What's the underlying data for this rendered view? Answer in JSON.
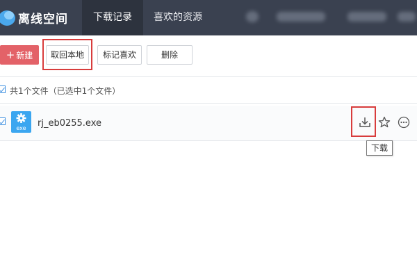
{
  "app": {
    "title": "离线空间",
    "icon": "cloud-logo-icon"
  },
  "tabs": [
    {
      "label": "下载记录",
      "active": true
    },
    {
      "label": "喜欢的资源",
      "active": false
    }
  ],
  "toolbar": {
    "new_label": "新建",
    "new_icon": "plus-icon",
    "fetch_label": "取回本地",
    "mark_label": "标记喜欢",
    "delete_label": "删除"
  },
  "summary": {
    "text": "共1个文件（已选中1个文件）",
    "checked": true
  },
  "files": [
    {
      "name": "rj_eb0255.exe",
      "type_label": "exe",
      "icon": "exe-file-icon",
      "checked": true,
      "actions": [
        "download-icon",
        "star-icon",
        "more-icon"
      ]
    }
  ],
  "tooltip": {
    "text": "下载"
  },
  "colors": {
    "topbar": "#3a4150",
    "active_tab": "#2d333e",
    "new_button": "#e36268",
    "highlight": "#d83c3c",
    "checkbox": "#3d8fe0",
    "file_icon": "#3ba6f0"
  }
}
